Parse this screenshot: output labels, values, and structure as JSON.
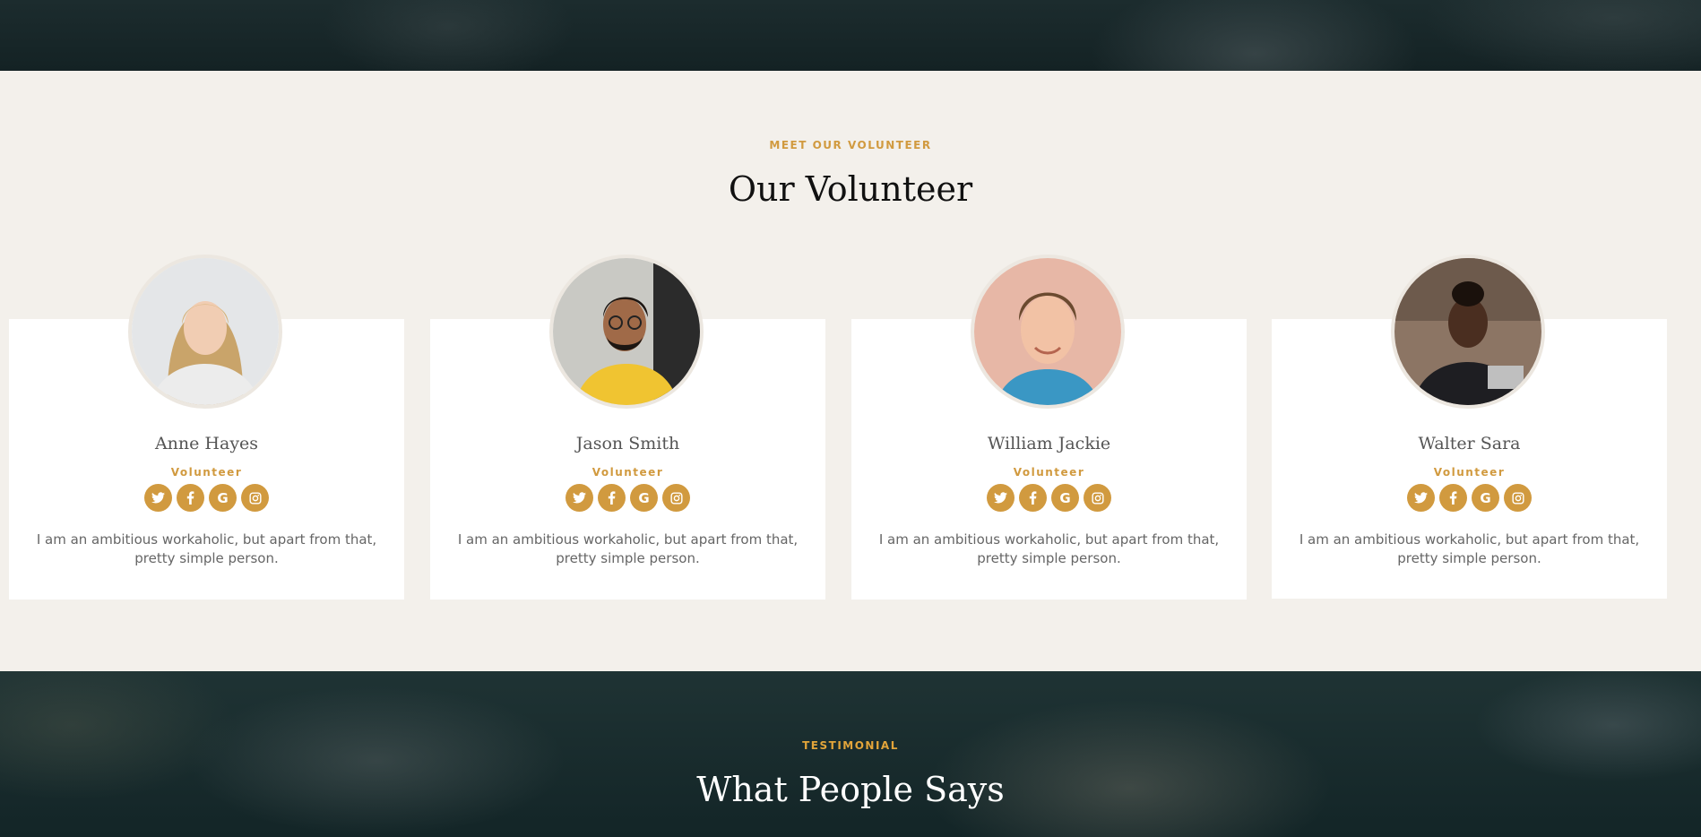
{
  "colors": {
    "accent": "#d19a3f",
    "section_bg": "#f3f0eb",
    "dark_bg": "#142224"
  },
  "volunteer": {
    "eyebrow": "MEET OUR VOLUNTEER",
    "title": "Our Volunteer",
    "members": [
      {
        "name": "Anne Hayes",
        "role": "Volunteer",
        "bio": "I am an ambitious workaholic, but apart from that, pretty simple person."
      },
      {
        "name": "Jason Smith",
        "role": "Volunteer",
        "bio": "I am an ambitious workaholic, but apart from that, pretty simple person."
      },
      {
        "name": "William Jackie",
        "role": "Volunteer",
        "bio": "I am an ambitious workaholic, but apart from that, pretty simple person."
      },
      {
        "name": "Walter Sara",
        "role": "Volunteer",
        "bio": "I am an ambitious workaholic, but apart from that, pretty simple person."
      }
    ],
    "social_icons": [
      "twitter-icon",
      "facebook-icon",
      "google-icon",
      "instagram-icon"
    ]
  },
  "testimonial": {
    "eyebrow": "TESTIMONIAL",
    "title": "What People Says"
  }
}
